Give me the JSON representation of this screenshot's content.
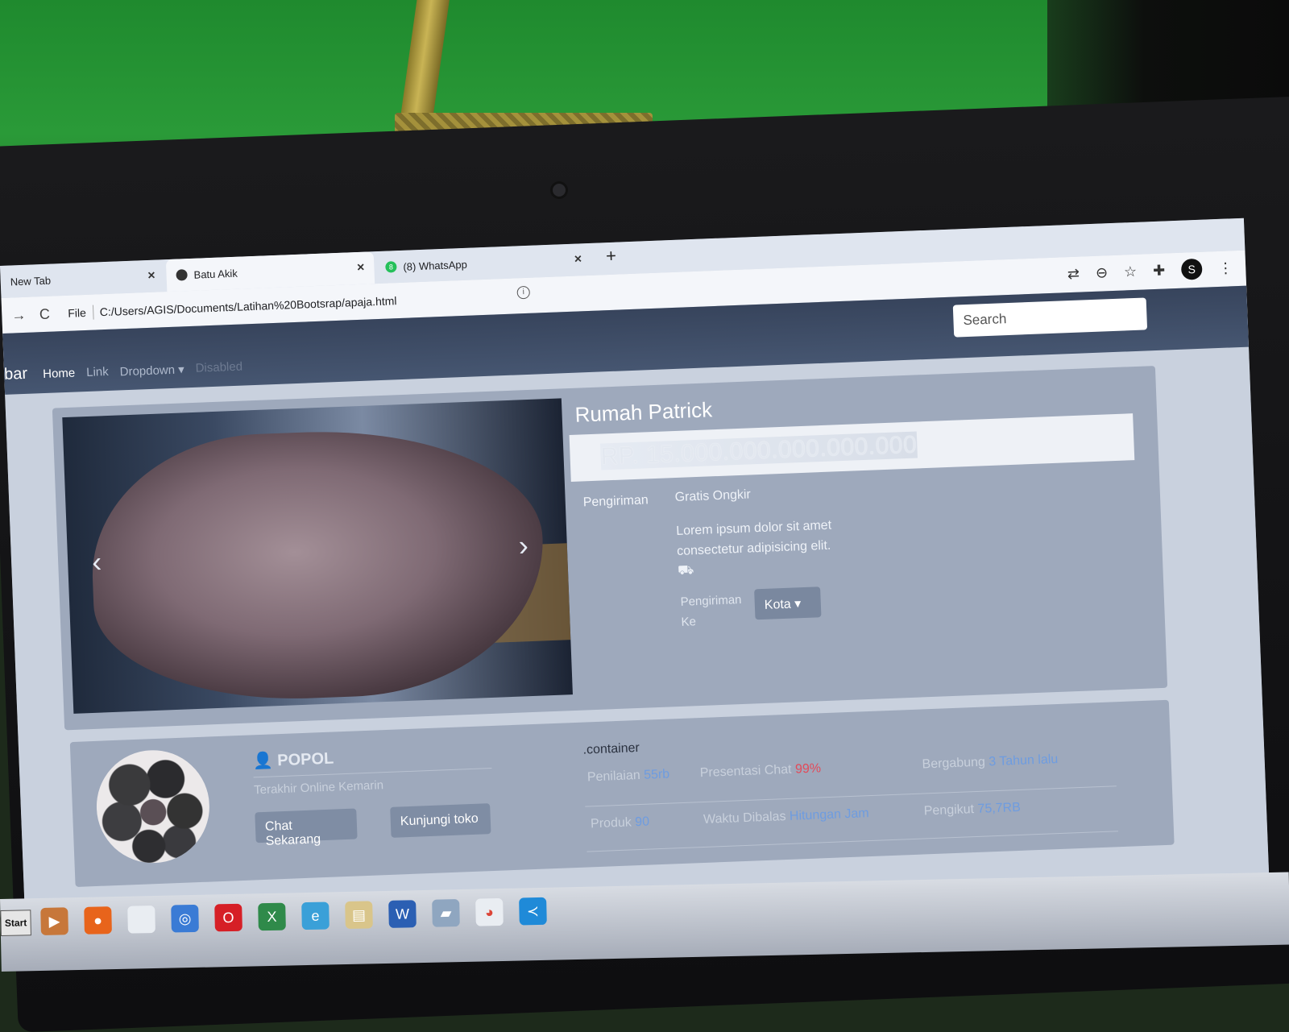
{
  "window": {
    "controls": [
      "▭",
      "❐",
      "✕"
    ],
    "profile_badge": "▼"
  },
  "tabs": [
    {
      "label": "New Tab",
      "close": "×"
    },
    {
      "label": "Batu Akik",
      "close": "×"
    },
    {
      "label": "(8) WhatsApp",
      "badge": "8",
      "close": "×"
    }
  ],
  "new_tab_button": "+",
  "toolbar": {
    "back": "←",
    "forward": "→",
    "reload": "C",
    "info_icon": "i",
    "scheme": "File",
    "url": "C:/Users/AGIS/Documents/Latihan%20Bootsrap/apaja.html",
    "avatar": "S",
    "icons": [
      "translate-icon",
      "zoom-out-icon",
      "star-icon",
      "extensions-icon",
      "menu-icon"
    ]
  },
  "navbar": {
    "brand": "bar",
    "links": [
      "Home",
      "Link",
      "Dropdown ▾",
      "Disabled"
    ],
    "search_placeholder": "Search"
  },
  "product": {
    "title": "Rumah Patrick",
    "price": "RP. 15.000.000.000.000.000",
    "shipping_label": "Pengiriman",
    "shipping_value": "Gratis Ongkir",
    "description": "Lorem ipsum dolor sit amet consectetur adipisicing elit.",
    "truck_icon": "⛟",
    "ship_to_label": "Pengiriman Ke",
    "city_button": "Kota ▾",
    "carousel_prev": "‹",
    "carousel_next": "›"
  },
  "seller": {
    "name": "👤 POPOL",
    "last_online": "Terakhir Online Kemarin",
    "chat_button": "Chat Sekarang",
    "visit_button": "Kunjungi toko",
    "container_label": ".container",
    "stats": {
      "penilaian_label": "Penilaian",
      "penilaian_value": "55rb",
      "chat_label": "Presentasi Chat",
      "chat_value": "99%",
      "join_label": "Bergabung",
      "join_value": "3 Tahun lalu",
      "produk_label": "Produk",
      "produk_value": "90",
      "reply_label": "Waktu Dibalas",
      "reply_value": "Hitungan Jam",
      "follow_label": "Pengikut",
      "follow_value": "75,7RB"
    }
  },
  "taskbar": {
    "start": "Start"
  },
  "colors": {
    "navbar": "#3f4d66",
    "card": "#9ea9bc",
    "accent_blue": "#6e9ce0",
    "accent_red": "#e24b5a",
    "wall_green": "#2a9a38"
  }
}
